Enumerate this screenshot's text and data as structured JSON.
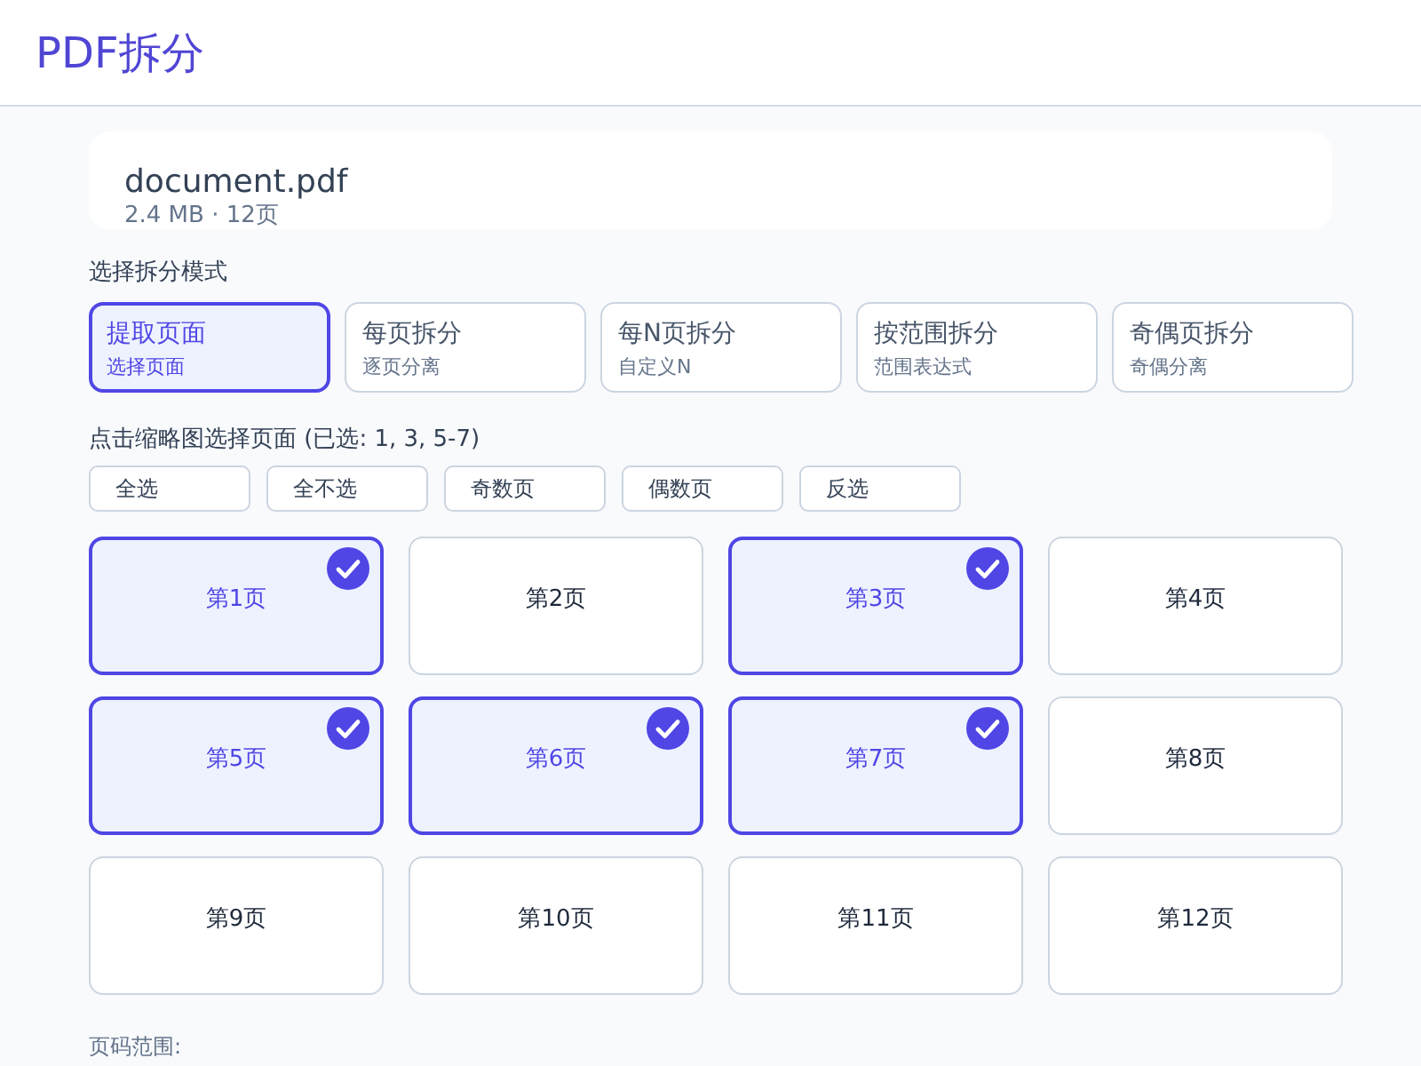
{
  "header": {
    "title": "PDF拆分"
  },
  "file": {
    "name": "document.pdf",
    "meta": "2.4 MB · 12页"
  },
  "mode_label": "选择拆分模式",
  "modes": [
    {
      "title": "提取页面",
      "subtitle": "选择页面",
      "selected": true
    },
    {
      "title": "每页拆分",
      "subtitle": "逐页分离",
      "selected": false
    },
    {
      "title": "每N页拆分",
      "subtitle": "自定义N",
      "selected": false
    },
    {
      "title": "按范围拆分",
      "subtitle": "范围表达式",
      "selected": false
    },
    {
      "title": "奇偶页拆分",
      "subtitle": "奇偶分离",
      "selected": false
    }
  ],
  "pages_label": "点击缩略图选择页面 (已选: 1, 3, 5-7)",
  "quick_actions": [
    "全选",
    "全不选",
    "奇数页",
    "偶数页",
    "反选"
  ],
  "pages": [
    {
      "label": "第1页",
      "selected": true
    },
    {
      "label": "第2页",
      "selected": false
    },
    {
      "label": "第3页",
      "selected": true
    },
    {
      "label": "第4页",
      "selected": false
    },
    {
      "label": "第5页",
      "selected": true
    },
    {
      "label": "第6页",
      "selected": true
    },
    {
      "label": "第7页",
      "selected": true
    },
    {
      "label": "第8页",
      "selected": false
    },
    {
      "label": "第9页",
      "selected": false
    },
    {
      "label": "第10页",
      "selected": false
    },
    {
      "label": "第11页",
      "selected": false
    },
    {
      "label": "第12页",
      "selected": false
    }
  ],
  "range_label": "页码范围:"
}
